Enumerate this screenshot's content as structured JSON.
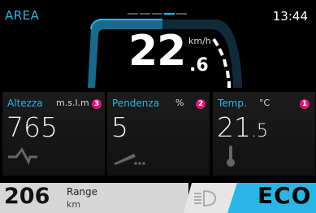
{
  "header": {
    "area_label": "AREA",
    "clock": "13:44",
    "page_count": 5,
    "active_page": 4
  },
  "speed": {
    "integer": "22",
    "decimal": ".6",
    "unit": "km/h"
  },
  "cards": [
    {
      "label": "Altezza",
      "unit": "m.s.l.m",
      "value": "765",
      "badge": "3",
      "icon": "mountain-icon"
    },
    {
      "label": "Pendenza",
      "unit": "%",
      "value": "5",
      "badge": "2",
      "icon": "slope-icon"
    },
    {
      "label": "Temp.",
      "unit": "°C",
      "value_int": "21",
      "value_dec": ".5",
      "badge": "1",
      "icon": "thermometer-icon"
    }
  ],
  "bottom": {
    "range_value": "206",
    "range_label": "Range",
    "range_unit": "km",
    "headlight_icon": "headlight-icon",
    "mode": "ECO"
  },
  "colors": {
    "accent": "#29b6e6",
    "badge": "#e0157a",
    "mode_bg": "#29b6e6",
    "bottom_bg": "#d6d6d6"
  }
}
